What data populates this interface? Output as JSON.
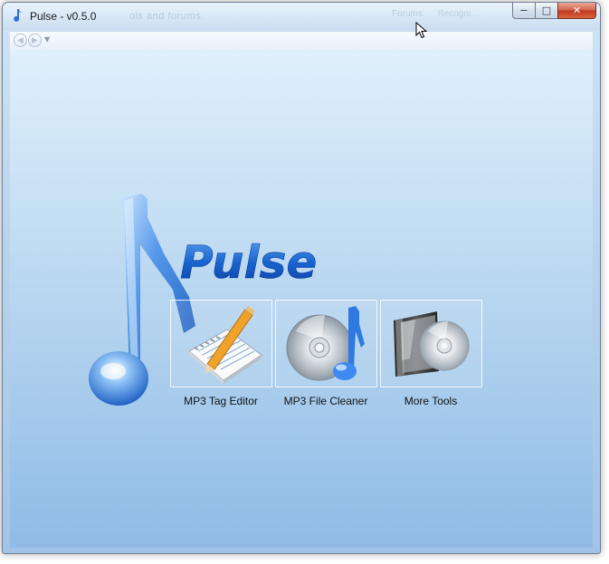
{
  "window": {
    "title": "Pulse - v0.5.0",
    "ghost_title_text": "ols and forums.",
    "ghost_right_text_1": "Forums",
    "ghost_right_text_2": "Recogni..."
  },
  "caption_buttons": {
    "minimize_icon": "minimize-icon",
    "maximize_icon": "maximize-icon",
    "close_icon": "close-icon"
  },
  "navigation": {
    "back_icon": "back-arrow-icon",
    "forward_icon": "forward-arrow-icon",
    "dropdown_icon": "chevron-down-icon"
  },
  "logo": {
    "wordmark": "Pulse",
    "icon": "music-note-icon"
  },
  "tools": [
    {
      "label": "MP3 Tag Editor",
      "icon": "notepad-pencil-icon"
    },
    {
      "label": "MP3 File Cleaner",
      "icon": "cd-music-note-icon"
    },
    {
      "label": "More Tools",
      "icon": "cd-case-icon"
    }
  ],
  "colors": {
    "accent_blue": "#1e6fd8",
    "background_top": "#dff0fb",
    "background_bottom": "#8fbbe6"
  }
}
